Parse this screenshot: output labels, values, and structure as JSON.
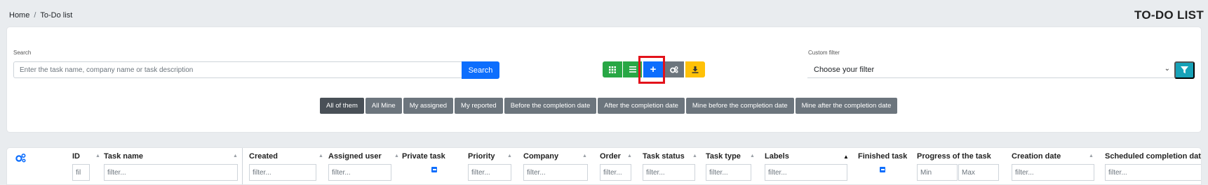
{
  "breadcrumb": {
    "home": "Home",
    "separator": "/",
    "current": "To-Do list"
  },
  "page_title": "TO-DO LIST",
  "search": {
    "label": "Search",
    "placeholder": "Enter the task name, company name or task description",
    "button": "Search"
  },
  "toolbar": {
    "buttons": [
      {
        "icon": "grid-icon",
        "color": "#28a745"
      },
      {
        "icon": "list-icon",
        "color": "#28a745"
      },
      {
        "icon": "plus-icon",
        "label": "+",
        "color": "#0d6efd"
      },
      {
        "icon": "gears-icon",
        "color": "#6c757d"
      },
      {
        "icon": "download-icon",
        "color": "#ffc107"
      }
    ]
  },
  "custom_filter": {
    "label": "Custom filter",
    "value": "Choose your filter",
    "button_icon": "funnel-icon",
    "button_color": "#17a2b8"
  },
  "quick_filters": [
    "All of them",
    "All Mine",
    "My assigned",
    "My reported",
    "Before the completion date",
    "After the completion date",
    "Mine before the completion date",
    "Mine after the completion date"
  ],
  "table": {
    "settings_icon": "gears-icon",
    "columns": {
      "id": {
        "label": "ID",
        "placeholder": "fil"
      },
      "task_name": {
        "label": "Task name",
        "placeholder": "filter..."
      },
      "created": {
        "label": "Created",
        "placeholder": "filter..."
      },
      "assigned_user": {
        "label": "Assigned user",
        "placeholder": "filter..."
      },
      "private_task": {
        "label": "Private task"
      },
      "priority": {
        "label": "Priority",
        "placeholder": "filter..."
      },
      "company": {
        "label": "Company",
        "placeholder": "filter..."
      },
      "order": {
        "label": "Order",
        "placeholder": "filter..."
      },
      "task_status": {
        "label": "Task status",
        "placeholder": "filter..."
      },
      "task_type": {
        "label": "Task type",
        "placeholder": "filter..."
      },
      "labels": {
        "label": "Labels",
        "placeholder": "filter..."
      },
      "finished_task": {
        "label": "Finished task"
      },
      "progress": {
        "label": "Progress of the task",
        "min_placeholder": "Min",
        "max_placeholder": "Max"
      },
      "creation_date": {
        "label": "Creation date",
        "placeholder": "filter..."
      },
      "scheduled_completion": {
        "label": "Scheduled completion date",
        "placeholder": "filter..."
      }
    }
  },
  "colors": {
    "accent": "#0d6efd",
    "highlight": "#e3121b",
    "pill": "#6c757d",
    "pill_active": "#495057"
  }
}
